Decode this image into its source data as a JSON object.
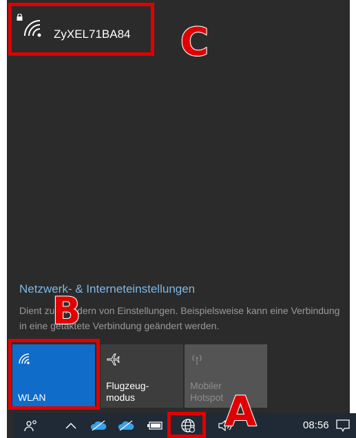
{
  "network": {
    "name": "ZyXEL71BA84",
    "secured": true
  },
  "settings": {
    "link_label": "Netzwerk- & Interneteinstellungen",
    "description": "Dient zum Ändern von Einstellungen. Beispielsweise kann eine Verbindung in eine getaktete Verbindung geändert werden."
  },
  "quick_actions": [
    {
      "label": "WLAN",
      "icon": "wifi-icon",
      "active": true
    },
    {
      "label": "Flugzeug-\nmodus",
      "icon": "airplane-icon",
      "active": false
    },
    {
      "label": "Mobiler\nHotspot",
      "icon": "hotspot-icon",
      "active": false,
      "disabled": true
    }
  ],
  "taskbar": {
    "time": "08:56",
    "icons": [
      "people-icon",
      "chevron-up-icon",
      "onedrive-icon",
      "onedrive-icon",
      "battery-icon",
      "network-globe-icon",
      "speaker-icon",
      "action-center-icon"
    ]
  },
  "callouts": {
    "a": "A",
    "b": "B",
    "c": "C"
  },
  "colors": {
    "panel_bg": "#2b2b2b",
    "accent": "#0f6cc9",
    "link": "#7eb8e8",
    "highlight": "#e00000",
    "taskbar_bg": "#1f2a36"
  }
}
